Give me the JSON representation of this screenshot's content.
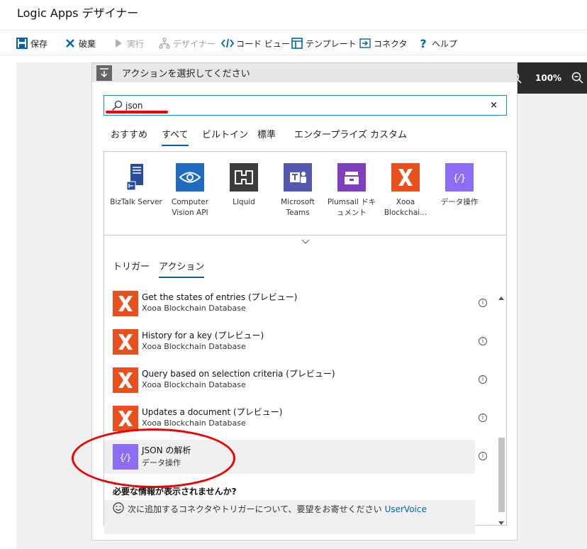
{
  "app": {
    "title": "Logic Apps デザイナー"
  },
  "toolbar": {
    "save": "保存",
    "discard": "破棄",
    "run": "実行",
    "designer": "デザイナー",
    "code_view": "コード ビュー",
    "templates": "テンプレート",
    "connectors": "コネクタ",
    "help": "ヘルプ"
  },
  "zoom": {
    "level": "100%"
  },
  "panel": {
    "header": "アクションを選択してください",
    "search": {
      "value": "json",
      "placeholder": ""
    },
    "tabs": [
      "おすすめ",
      "すべて",
      "ビルトイン",
      "標準",
      "エンタープライズ",
      "カスタム"
    ],
    "active_tab": "すべて",
    "connectors": [
      {
        "name_line1": "BizTalk Server",
        "name_line2": "",
        "color": "#2a4d9b",
        "icon": "biztalk-icon"
      },
      {
        "name_line1": "Computer",
        "name_line2": "Vision API",
        "color": "#1f6bbf",
        "icon": "eye-icon"
      },
      {
        "name_line1": "Liquid",
        "name_line2": "",
        "color": "#3c3c3c",
        "icon": "liquid-icon"
      },
      {
        "name_line1": "Microsoft",
        "name_line2": "Teams",
        "color": "#5558af",
        "icon": "teams-icon"
      },
      {
        "name_line1": "Plumsail ドキ",
        "name_line2": "ュメント",
        "color": "#7f3fbf",
        "icon": "plumsail-icon"
      },
      {
        "name_line1": "Xooa",
        "name_line2": "Blockchai...",
        "color": "#e8501e",
        "icon": "xooa-icon"
      },
      {
        "name_line1": "データ操作",
        "name_line2": "",
        "color": "#8c6cf2",
        "icon": "data-operations-icon"
      }
    ],
    "subtabs": [
      "トリガー",
      "アクション"
    ],
    "actions": [
      {
        "name": "Get the states of entries (プレビュー)",
        "connector": "Xooa Blockchain Database",
        "color": "#e8501e",
        "icon": "xooa-icon"
      },
      {
        "name": "History for a key (プレビュー)",
        "connector": "Xooa Blockchain Database",
        "color": "#e8501e",
        "icon": "xooa-icon"
      },
      {
        "name": "Query based on selection criteria (プレビュー)",
        "connector": "Xooa Blockchain Database",
        "color": "#e8501e",
        "icon": "xooa-icon"
      },
      {
        "name": "Updates a document (プレビュー)",
        "connector": "Xooa Blockchain Database",
        "color": "#e8501e",
        "icon": "xooa-icon"
      },
      {
        "name": "JSON の解析",
        "connector": "データ操作",
        "color": "#8c6cf2",
        "icon": "data-operations-icon"
      }
    ],
    "footer": {
      "question": "必要な情報が表示されませんか?",
      "text": "次に追加するコネクタやトリガーについて、要望をお寄せください",
      "link": "UserVoice"
    }
  }
}
